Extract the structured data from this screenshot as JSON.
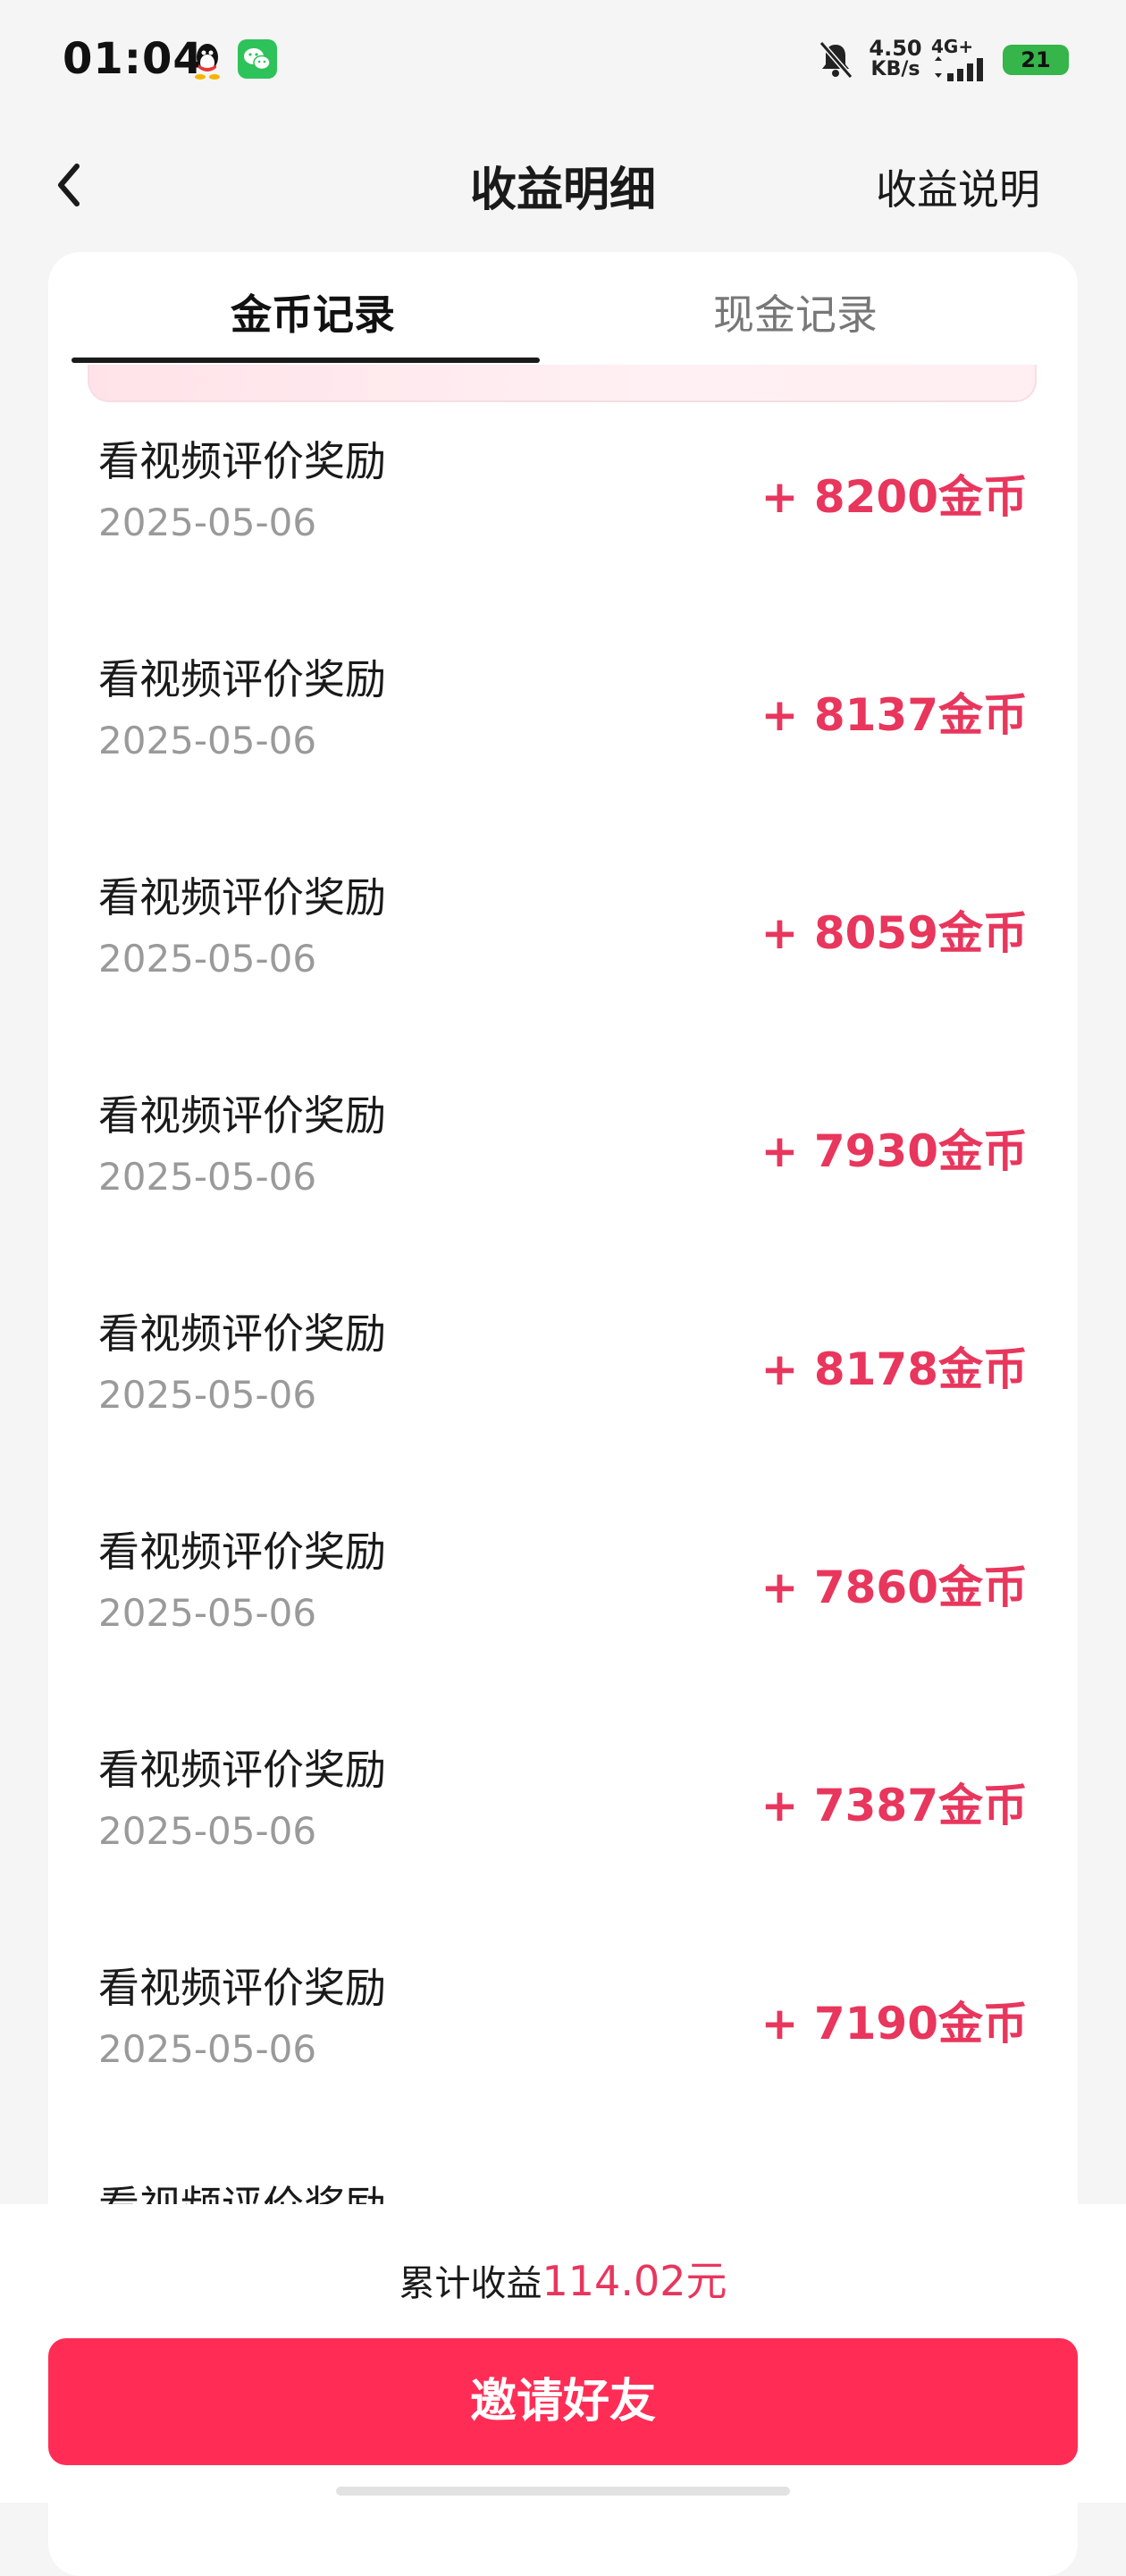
{
  "status": {
    "time": "01:04",
    "net_speed_value": "4.50",
    "net_speed_unit": "KB/s",
    "network": "4G+",
    "battery": "21",
    "icons": [
      "qq-icon",
      "wechat-icon",
      "mute-bell-icon",
      "signal-icon",
      "battery-icon"
    ]
  },
  "header": {
    "title": "收益明细",
    "help": "收益说明",
    "back_icon": "chevron-left-icon"
  },
  "tabs": [
    {
      "label": "金币记录",
      "active": true
    },
    {
      "label": "现金记录",
      "active": false
    }
  ],
  "records": [
    {
      "title": "看视频评价奖励",
      "date": "2025-05-06",
      "amount": "+ 8200金币"
    },
    {
      "title": "看视频评价奖励",
      "date": "2025-05-06",
      "amount": "+ 8137金币"
    },
    {
      "title": "看视频评价奖励",
      "date": "2025-05-06",
      "amount": "+ 8059金币"
    },
    {
      "title": "看视频评价奖励",
      "date": "2025-05-06",
      "amount": "+ 7930金币"
    },
    {
      "title": "看视频评价奖励",
      "date": "2025-05-06",
      "amount": "+ 8178金币"
    },
    {
      "title": "看视频评价奖励",
      "date": "2025-05-06",
      "amount": "+ 7860金币"
    },
    {
      "title": "看视频评价奖励",
      "date": "2025-05-06",
      "amount": "+ 7387金币"
    },
    {
      "title": "看视频评价奖励",
      "date": "2025-05-06",
      "amount": "+ 7190金币"
    },
    {
      "title": "看视频评价奖励",
      "date": "",
      "amount": ""
    }
  ],
  "footer": {
    "total_label": "累计收益",
    "total_value": "114.02元",
    "invite_button": "邀请好友"
  },
  "colors": {
    "accent": "#ff2d55",
    "amount": "#e8365d",
    "battery": "#35b54a",
    "wechat": "#2dc35a"
  }
}
